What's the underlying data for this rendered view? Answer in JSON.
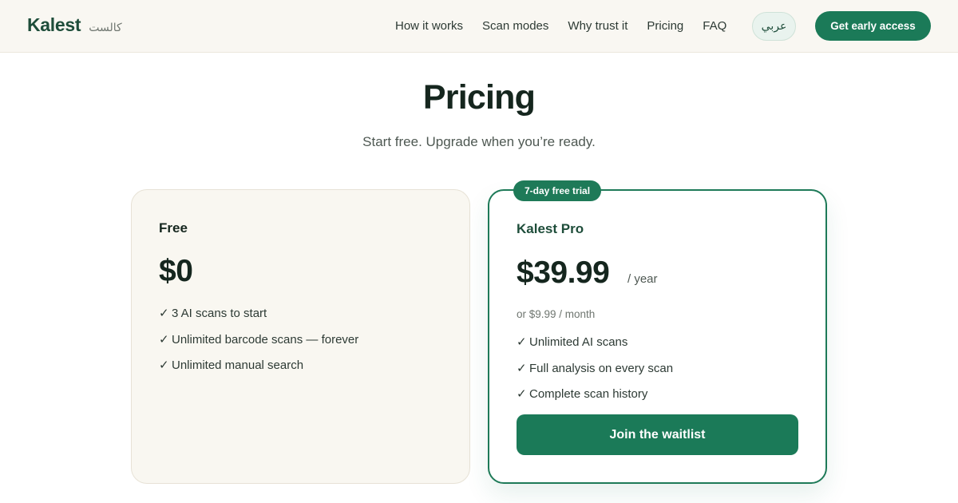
{
  "header": {
    "logo": "Kalest",
    "logo_arabic": "كالست",
    "nav": [
      "How it works",
      "Scan modes",
      "Why trust it",
      "Pricing",
      "FAQ"
    ],
    "lang_button": "عربي",
    "cta": "Get early access"
  },
  "pricing": {
    "title": "Pricing",
    "subtitle": "Start free. Upgrade when you’re ready.",
    "free": {
      "name": "Free",
      "price": "$0",
      "features": [
        "3 AI scans to start",
        "Unlimited barcode scans — forever",
        "Unlimited manual search"
      ]
    },
    "pro": {
      "badge": "7-day free trial",
      "name": "Kalest Pro",
      "price": "$39.99",
      "period": "/ year",
      "alt_price": "or $9.99 / month",
      "features": [
        "Unlimited AI scans",
        "Full analysis on every scan",
        "Complete scan history"
      ],
      "button": "Join the waitlist"
    }
  },
  "icons": {
    "check": "✓"
  },
  "colors": {
    "brand": "#1b7a58",
    "brand_dark": "#1e4d3a",
    "header_bg": "#f9f7f2",
    "free_card_bg": "#f9f7f1"
  }
}
